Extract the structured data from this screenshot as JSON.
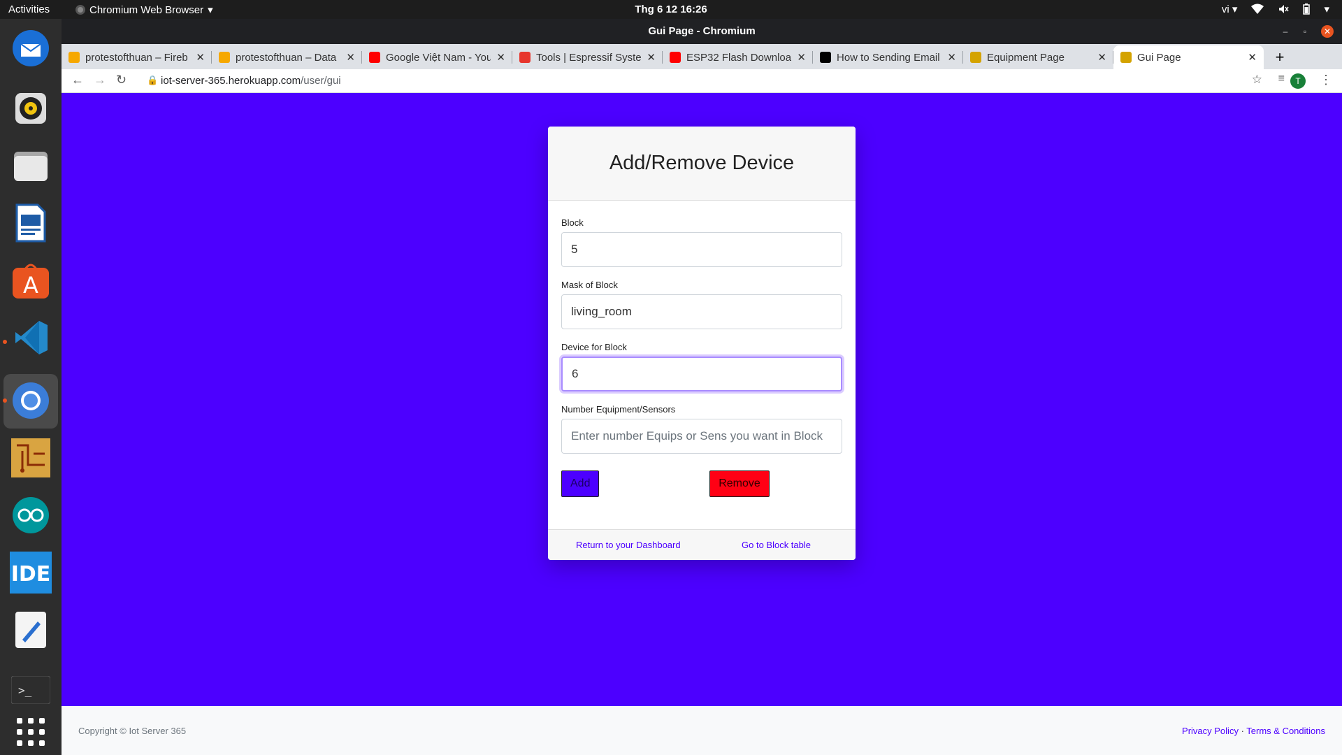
{
  "os": {
    "activities": "Activities",
    "app_menu": "Chromium Web Browser",
    "clock": "Thg 6 12  16:26",
    "lang": "vi"
  },
  "dock": {
    "items": [
      "thunderbird-icon",
      "rhythmbox-icon",
      "files-icon",
      "writer-icon",
      "software-icon",
      "vscode-icon",
      "chromium-icon",
      "fritzing-icon",
      "arduino-icon",
      "ide-icon",
      "text-editor-icon",
      "terminal-icon",
      "app-grid-icon"
    ]
  },
  "browser": {
    "window_title": "Gui Page - Chromium",
    "tabs": [
      {
        "label": "protestofthuan – Fireb",
        "favicon_color": "#f6a800"
      },
      {
        "label": "protestofthuan – Data",
        "favicon_color": "#f6a800"
      },
      {
        "label": "Google Việt Nam - You",
        "favicon_color": "#ff0000"
      },
      {
        "label": "Tools | Espressif Syste",
        "favicon_color": "#e7352c"
      },
      {
        "label": "ESP32 Flash Downloa",
        "favicon_color": "#ff0000"
      },
      {
        "label": "How to Sending Email",
        "favicon_color": "#000000"
      },
      {
        "label": "Equipment Page",
        "favicon_color": "#d4a300"
      },
      {
        "label": "Gui Page",
        "favicon_color": "#d4a300"
      }
    ],
    "url_host": "iot-server-365.herokuapp.com",
    "url_path": "/user/gui",
    "profile_initial": "T"
  },
  "form": {
    "title": "Add/Remove Device",
    "block_label": "Block",
    "block_value": "5",
    "mask_label": "Mask of Block",
    "mask_value": "living_room",
    "device_label": "Device for Block",
    "device_value": "6",
    "number_label": "Number Equipment/Sensors",
    "number_placeholder": "Enter number Equips or Sens you want in Block",
    "add_label": "Add",
    "remove_label": "Remove",
    "dashboard_link": "Return to your Dashboard",
    "block_table_link": "Go to Block table"
  },
  "footer": {
    "copyright": "Copyright © Iot Server 365",
    "privacy": "Privacy Policy",
    "separator": " · ",
    "terms": "Terms & Conditions"
  },
  "colors": {
    "primary": "#4c00ff",
    "danger": "#ff0014"
  }
}
